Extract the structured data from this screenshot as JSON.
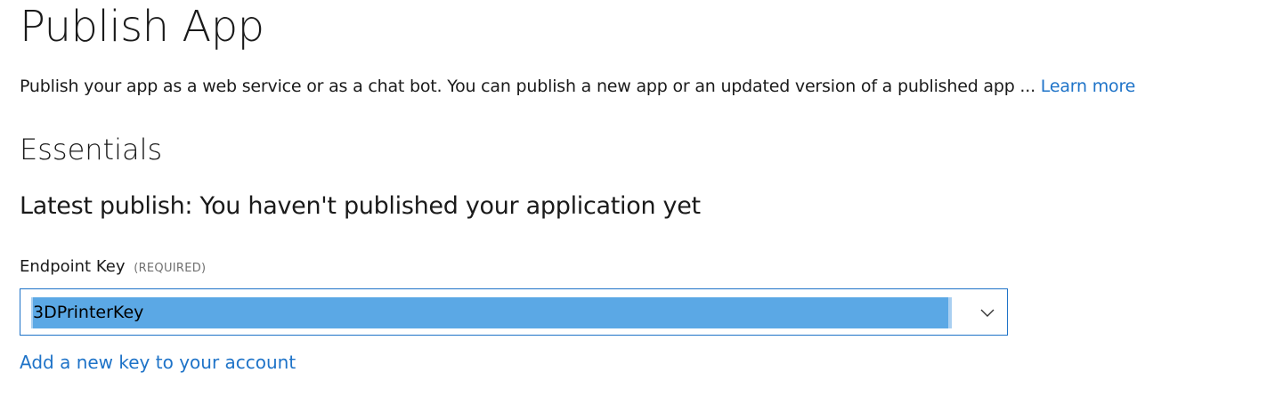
{
  "page": {
    "title": "Publish App",
    "description": "Publish your app as a web service or as a chat bot. You can publish a new app or an updated version of a published app ...",
    "learn_more_label": "Learn more"
  },
  "essentials": {
    "heading": "Essentials",
    "latest_publish": "Latest publish: You haven't published your application yet"
  },
  "endpoint_key": {
    "label": "Endpoint Key",
    "required_tag": "(REQUIRED)",
    "selected_value": "3DPrinterKey",
    "chevron_icon": "chevron-down-icon"
  },
  "add_key_link": "Add a new key to your account",
  "colors": {
    "link": "#1e73c8",
    "selection_highlight": "#5ba8e5",
    "select_border": "#1e73c8"
  }
}
